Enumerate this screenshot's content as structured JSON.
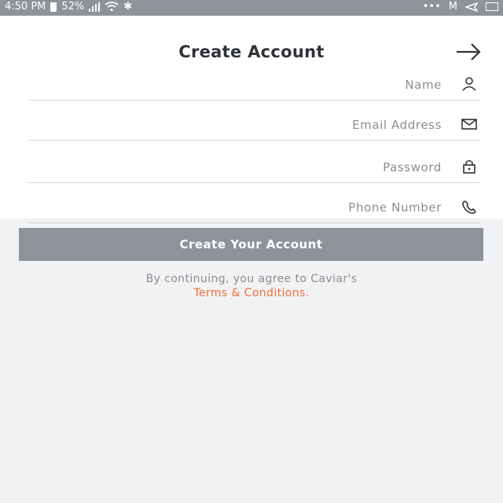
{
  "status_bar": {
    "time": "4:50 PM",
    "battery": "52%",
    "icons": [
      "battery-icon",
      "signal-icon",
      "wifi-icon",
      "bluetooth-icon",
      "more-icon",
      "mail-icon",
      "send-icon",
      "gallery-icon"
    ]
  },
  "header": {
    "title": "Create Account"
  },
  "form": {
    "name_placeholder": "Name",
    "email_placeholder": "Email Address",
    "password_placeholder": "Password",
    "phone_placeholder": "Phone Number"
  },
  "actions": {
    "create_label": "Create Your Account"
  },
  "terms": {
    "text": "By continuing, you agree to Caviar's",
    "link": "Terms & Conditions",
    "period": "."
  },
  "colors": {
    "accent": "#f36c3a",
    "button": "#8e939a",
    "background": "#f1f2f4"
  }
}
